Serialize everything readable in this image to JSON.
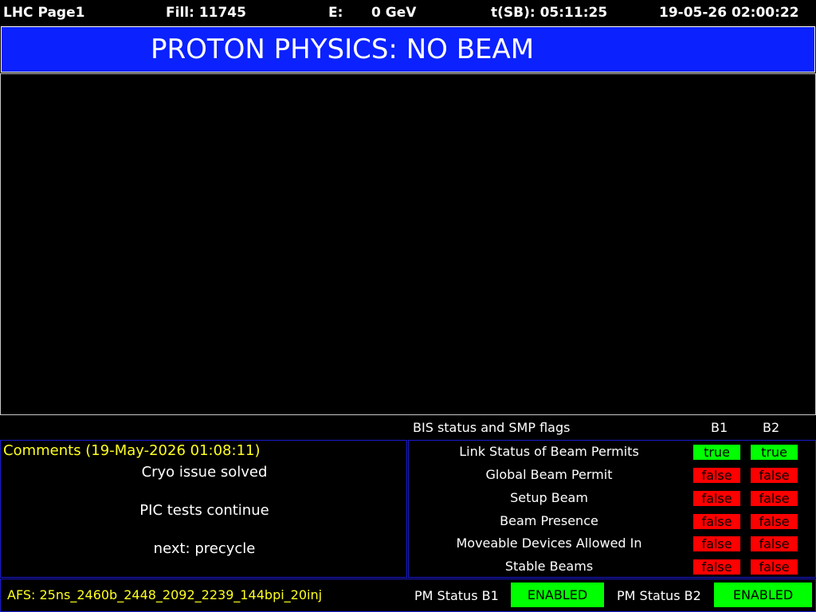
{
  "header": {
    "page": "LHC Page1",
    "fill": "Fill: 11745",
    "energy_label": "E:",
    "energy_value": "0 GeV",
    "tsb": "t(SB): 05:11:25",
    "datetime": "19-05-26 02:00:22"
  },
  "banner": {
    "text": "PROTON PHYSICS: NO BEAM"
  },
  "bis": {
    "title": "BIS status and SMP flags",
    "col_b1": "B1",
    "col_b2": "B2",
    "rows": [
      {
        "label": "Link Status of Beam Permits",
        "b1": "true",
        "b2": "true"
      },
      {
        "label": "Global Beam Permit",
        "b1": "false",
        "b2": "false"
      },
      {
        "label": "Setup Beam",
        "b1": "false",
        "b2": "false"
      },
      {
        "label": "Beam Presence",
        "b1": "false",
        "b2": "false"
      },
      {
        "label": "Moveable Devices Allowed In",
        "b1": "false",
        "b2": "false"
      },
      {
        "label": "Stable Beams",
        "b1": "false",
        "b2": "false"
      }
    ]
  },
  "comments": {
    "title": "Comments (19-May-2026 01:08:11)",
    "lines": [
      "Cryo issue solved",
      "PIC tests continue",
      "next: precycle"
    ]
  },
  "footer": {
    "afs": "AFS: 25ns_2460b_2448_2092_2239_144bpi_20inj",
    "pm_b1_label": "PM Status B1",
    "pm_b1_value": "ENABLED",
    "pm_b2_label": "PM Status B2",
    "pm_b2_value": "ENABLED"
  },
  "colors": {
    "banner_bg": "#0b21fe",
    "true_bg": "#00ff00",
    "false_bg": "#ff0000",
    "comment_title": "#ffff20",
    "box_border": "#1a1ad0"
  }
}
